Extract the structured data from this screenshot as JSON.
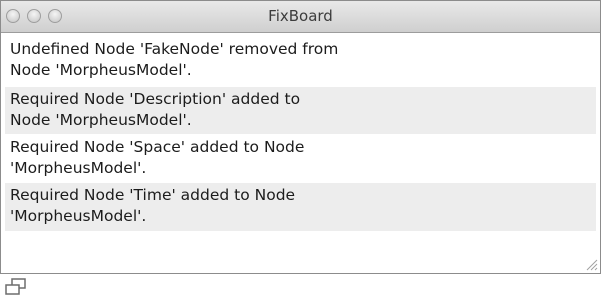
{
  "window": {
    "title": "FixBoard"
  },
  "messages": [
    {
      "text": "Undefined Node 'FakeNode' removed from\nNode 'MorpheusModel'."
    },
    {
      "text": "Required Node 'Description' added to\nNode 'MorpheusModel'."
    },
    {
      "text": "Required Node 'Space' added to Node\n'MorpheusModel'."
    },
    {
      "text": "Required Node 'Time' added to Node\n'MorpheusModel'."
    }
  ],
  "icons": {
    "window_controls": [
      "close-icon",
      "minimize-icon",
      "zoom-icon"
    ],
    "resize": "resize-grip-icon",
    "bottom": "window-restore-icon"
  },
  "colors": {
    "row_alt": "#ededed",
    "titlebar_top": "#e9e9e9",
    "titlebar_bottom": "#cfcfcf"
  }
}
